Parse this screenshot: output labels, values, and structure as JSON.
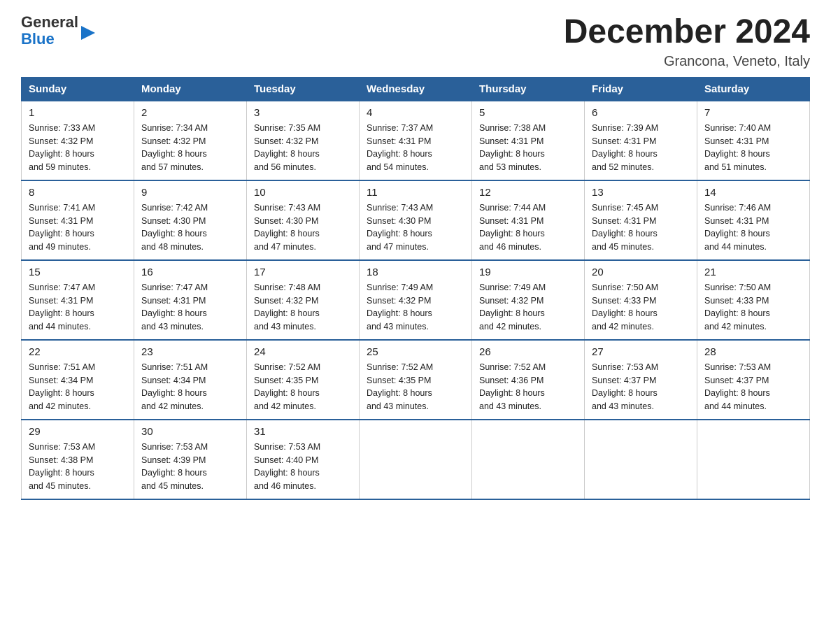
{
  "header": {
    "logo_general": "General",
    "logo_triangle": "▶",
    "logo_blue": "Blue",
    "month_title": "December 2024",
    "location": "Grancona, Veneto, Italy"
  },
  "weekdays": [
    "Sunday",
    "Monday",
    "Tuesday",
    "Wednesday",
    "Thursday",
    "Friday",
    "Saturday"
  ],
  "weeks": [
    [
      {
        "day": "1",
        "sunrise": "7:33 AM",
        "sunset": "4:32 PM",
        "daylight": "8 hours and 59 minutes."
      },
      {
        "day": "2",
        "sunrise": "7:34 AM",
        "sunset": "4:32 PM",
        "daylight": "8 hours and 57 minutes."
      },
      {
        "day": "3",
        "sunrise": "7:35 AM",
        "sunset": "4:32 PM",
        "daylight": "8 hours and 56 minutes."
      },
      {
        "day": "4",
        "sunrise": "7:37 AM",
        "sunset": "4:31 PM",
        "daylight": "8 hours and 54 minutes."
      },
      {
        "day": "5",
        "sunrise": "7:38 AM",
        "sunset": "4:31 PM",
        "daylight": "8 hours and 53 minutes."
      },
      {
        "day": "6",
        "sunrise": "7:39 AM",
        "sunset": "4:31 PM",
        "daylight": "8 hours and 52 minutes."
      },
      {
        "day": "7",
        "sunrise": "7:40 AM",
        "sunset": "4:31 PM",
        "daylight": "8 hours and 51 minutes."
      }
    ],
    [
      {
        "day": "8",
        "sunrise": "7:41 AM",
        "sunset": "4:31 PM",
        "daylight": "8 hours and 49 minutes."
      },
      {
        "day": "9",
        "sunrise": "7:42 AM",
        "sunset": "4:30 PM",
        "daylight": "8 hours and 48 minutes."
      },
      {
        "day": "10",
        "sunrise": "7:43 AM",
        "sunset": "4:30 PM",
        "daylight": "8 hours and 47 minutes."
      },
      {
        "day": "11",
        "sunrise": "7:43 AM",
        "sunset": "4:30 PM",
        "daylight": "8 hours and 47 minutes."
      },
      {
        "day": "12",
        "sunrise": "7:44 AM",
        "sunset": "4:31 PM",
        "daylight": "8 hours and 46 minutes."
      },
      {
        "day": "13",
        "sunrise": "7:45 AM",
        "sunset": "4:31 PM",
        "daylight": "8 hours and 45 minutes."
      },
      {
        "day": "14",
        "sunrise": "7:46 AM",
        "sunset": "4:31 PM",
        "daylight": "8 hours and 44 minutes."
      }
    ],
    [
      {
        "day": "15",
        "sunrise": "7:47 AM",
        "sunset": "4:31 PM",
        "daylight": "8 hours and 44 minutes."
      },
      {
        "day": "16",
        "sunrise": "7:47 AM",
        "sunset": "4:31 PM",
        "daylight": "8 hours and 43 minutes."
      },
      {
        "day": "17",
        "sunrise": "7:48 AM",
        "sunset": "4:32 PM",
        "daylight": "8 hours and 43 minutes."
      },
      {
        "day": "18",
        "sunrise": "7:49 AM",
        "sunset": "4:32 PM",
        "daylight": "8 hours and 43 minutes."
      },
      {
        "day": "19",
        "sunrise": "7:49 AM",
        "sunset": "4:32 PM",
        "daylight": "8 hours and 42 minutes."
      },
      {
        "day": "20",
        "sunrise": "7:50 AM",
        "sunset": "4:33 PM",
        "daylight": "8 hours and 42 minutes."
      },
      {
        "day": "21",
        "sunrise": "7:50 AM",
        "sunset": "4:33 PM",
        "daylight": "8 hours and 42 minutes."
      }
    ],
    [
      {
        "day": "22",
        "sunrise": "7:51 AM",
        "sunset": "4:34 PM",
        "daylight": "8 hours and 42 minutes."
      },
      {
        "day": "23",
        "sunrise": "7:51 AM",
        "sunset": "4:34 PM",
        "daylight": "8 hours and 42 minutes."
      },
      {
        "day": "24",
        "sunrise": "7:52 AM",
        "sunset": "4:35 PM",
        "daylight": "8 hours and 42 minutes."
      },
      {
        "day": "25",
        "sunrise": "7:52 AM",
        "sunset": "4:35 PM",
        "daylight": "8 hours and 43 minutes."
      },
      {
        "day": "26",
        "sunrise": "7:52 AM",
        "sunset": "4:36 PM",
        "daylight": "8 hours and 43 minutes."
      },
      {
        "day": "27",
        "sunrise": "7:53 AM",
        "sunset": "4:37 PM",
        "daylight": "8 hours and 43 minutes."
      },
      {
        "day": "28",
        "sunrise": "7:53 AM",
        "sunset": "4:37 PM",
        "daylight": "8 hours and 44 minutes."
      }
    ],
    [
      {
        "day": "29",
        "sunrise": "7:53 AM",
        "sunset": "4:38 PM",
        "daylight": "8 hours and 45 minutes."
      },
      {
        "day": "30",
        "sunrise": "7:53 AM",
        "sunset": "4:39 PM",
        "daylight": "8 hours and 45 minutes."
      },
      {
        "day": "31",
        "sunrise": "7:53 AM",
        "sunset": "4:40 PM",
        "daylight": "8 hours and 46 minutes."
      },
      null,
      null,
      null,
      null
    ]
  ],
  "labels": {
    "sunrise": "Sunrise:",
    "sunset": "Sunset:",
    "daylight": "Daylight:"
  }
}
